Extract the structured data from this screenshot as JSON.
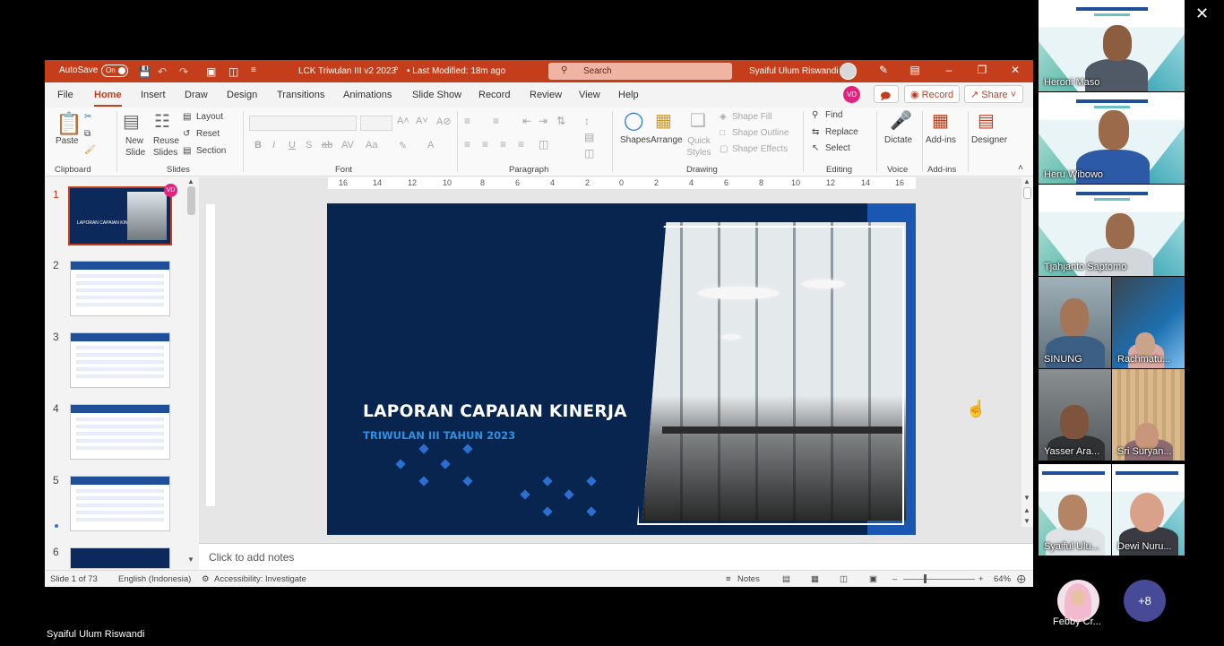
{
  "window": {
    "autosave_label": "AutoSave",
    "autosave_state": "On",
    "doc_title": "LCK Triwulan III v2 2023",
    "modified": "• Last Modified: 18m ago",
    "search_placeholder": "Search",
    "user_name": "Syaiful Ulum Riswandi"
  },
  "menu": {
    "tabs": [
      "File",
      "Home",
      "Insert",
      "Draw",
      "Design",
      "Transitions",
      "Animations",
      "Slide Show",
      "Record",
      "Review",
      "View",
      "Help"
    ],
    "active_tab": "Home",
    "user_badge": "VD",
    "record_label": "Record",
    "share_label": "Share"
  },
  "ribbon": {
    "clipboard": {
      "paste": "Paste",
      "group": "Clipboard"
    },
    "slides": {
      "new_slide": "New Slide",
      "reuse_slides": "Reuse Slides",
      "layout": "Layout",
      "reset": "Reset",
      "section": "Section",
      "group": "Slides"
    },
    "font": {
      "group": "Font"
    },
    "paragraph": {
      "group": "Paragraph"
    },
    "drawing": {
      "shapes": "Shapes",
      "arrange": "Arrange",
      "quick_styles": "Quick Styles",
      "shape_fill": "Shape Fill",
      "shape_outline": "Shape Outline",
      "shape_effects": "Shape Effects",
      "group": "Drawing"
    },
    "editing": {
      "find": "Find",
      "replace": "Replace",
      "select": "Select",
      "group": "Editing"
    },
    "voice": {
      "dictate": "Dictate",
      "group": "Voice"
    },
    "addins": {
      "addins": "Add-ins",
      "group": "Add-ins"
    },
    "designer": {
      "designer": "Designer"
    }
  },
  "thumbnails": [
    {
      "num": "1",
      "active": true
    },
    {
      "num": "2"
    },
    {
      "num": "3"
    },
    {
      "num": "4"
    },
    {
      "num": "5"
    },
    {
      "num": "6"
    }
  ],
  "thumb1_title": "LAPORAN CAPAIAN KINERJA",
  "ruler_ticks": [
    "16",
    "14",
    "12",
    "10",
    "8",
    "6",
    "4",
    "2",
    "0",
    "2",
    "4",
    "6",
    "8",
    "10",
    "12",
    "14",
    "16"
  ],
  "slide": {
    "title": "LAPORAN CAPAIAN KINERJA",
    "subtitle": "TRIWULAN III TAHUN 2023"
  },
  "notes_placeholder": "Click to add notes",
  "status": {
    "slide_count": "Slide 1 of 73",
    "language": "English (Indonesia)",
    "accessibility": "Accessibility: Investigate",
    "notes": "Notes",
    "zoom": "64%"
  },
  "participants": [
    {
      "name": "Heroni Maso"
    },
    {
      "name": "Heru Wibowo"
    },
    {
      "name": "Tjahjanto Saptomo"
    },
    {
      "name": "SINUNG"
    },
    {
      "name": "Rachmatu..."
    },
    {
      "name": "Yasser Ara..."
    },
    {
      "name": "Sri Suryan..."
    },
    {
      "name": "Syaiful Ulu..."
    },
    {
      "name": "Dewi Nuru..."
    }
  ],
  "extra_participant": {
    "name": "Febby Cr..."
  },
  "more_count": "+8",
  "presenter_label": "Syaiful Ulum Riswandi",
  "colors": {
    "accent": "#c43e1c",
    "slide_bg": "#07254f",
    "slide_sub": "#2f8fe0",
    "meeting_more": "#474a96"
  }
}
